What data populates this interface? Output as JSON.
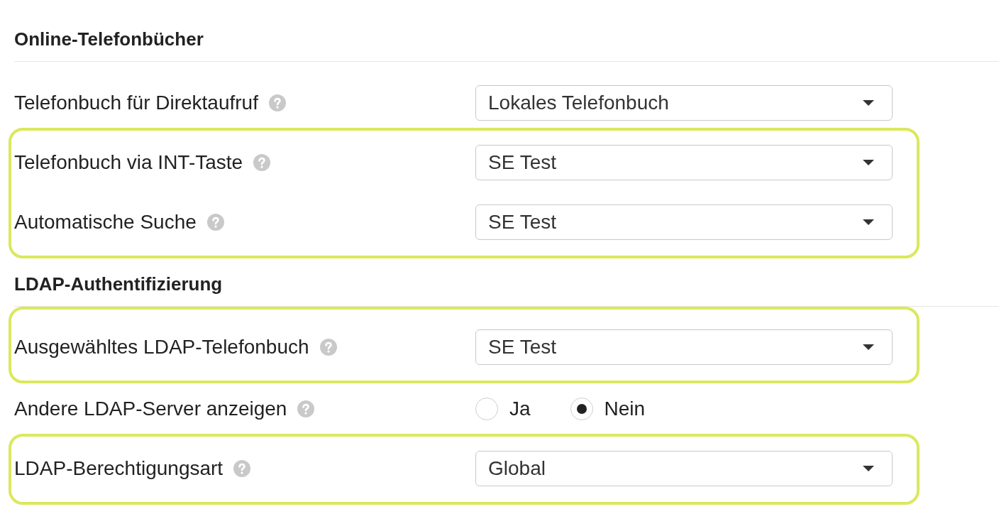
{
  "sections": [
    {
      "title": "Online-Telefonbücher",
      "groups": [
        {
          "highlighted": false,
          "rows": [
            {
              "kind": "select",
              "label": "Telefonbuch für Direktaufruf",
              "value": "Lokales Telefonbuch"
            }
          ]
        },
        {
          "highlighted": true,
          "rows": [
            {
              "kind": "select",
              "label": "Telefonbuch via INT-Taste",
              "value": "SE Test"
            },
            {
              "kind": "select",
              "label": "Automatische Suche",
              "value": "SE Test"
            }
          ]
        }
      ]
    },
    {
      "title": "LDAP-Authentifizierung",
      "groups": [
        {
          "highlighted": true,
          "rows": [
            {
              "kind": "select",
              "label": "Ausgewähltes LDAP-Telefonbuch",
              "value": "SE Test"
            }
          ]
        },
        {
          "highlighted": false,
          "rows": [
            {
              "kind": "radio",
              "label": "Andere LDAP-Server anzeigen",
              "options": [
                {
                  "label": "Ja",
                  "selected": false
                },
                {
                  "label": "Nein",
                  "selected": true
                }
              ]
            }
          ]
        },
        {
          "highlighted": true,
          "rows": [
            {
              "kind": "select",
              "label": "LDAP-Berechtigungsart",
              "value": "Global"
            }
          ]
        }
      ]
    }
  ]
}
